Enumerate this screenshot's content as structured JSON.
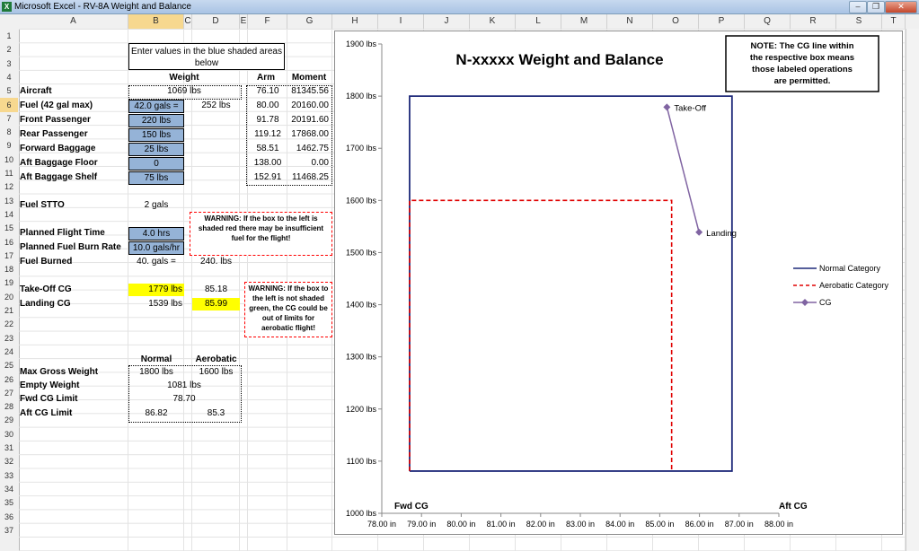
{
  "window": {
    "title": "Microsoft Excel - RV-8A Weight and Balance",
    "app_icon": "excel-icon",
    "buttons": [
      "minimize",
      "restore",
      "close"
    ]
  },
  "columns": [
    "A",
    "B",
    "C",
    "D",
    "E",
    "F",
    "G",
    "H",
    "I",
    "J",
    "K",
    "L",
    "M",
    "N",
    "O",
    "P",
    "Q",
    "R",
    "S",
    "T"
  ],
  "selected_column": "B",
  "rows": [
    "1",
    "2",
    "3",
    "4",
    "5",
    "6",
    "7",
    "8",
    "9",
    "10",
    "11",
    "12",
    "13",
    "14",
    "15",
    "16",
    "17",
    "18",
    "19",
    "20",
    "21",
    "22",
    "23",
    "24",
    "25",
    "26",
    "27",
    "28",
    "29",
    "30",
    "31",
    "32",
    "33",
    "34",
    "35",
    "36",
    "37"
  ],
  "selected_row": "6",
  "sheet": {
    "instruction": "Enter values in the blue shaded areas below",
    "headers": {
      "weight": "Weight",
      "arm": "Arm",
      "moment": "Moment"
    },
    "items": [
      {
        "label": "Aircraft",
        "weight": "1069 lbs",
        "weight2": "",
        "arm": "76.10",
        "moment": "81345.56"
      },
      {
        "label": "Fuel (42 gal max)",
        "weight": "42.0 gals =",
        "weight2": "252 lbs",
        "arm": "80.00",
        "moment": "20160.00"
      },
      {
        "label": "Front Passenger",
        "weight": "220 lbs",
        "weight2": "",
        "arm": "91.78",
        "moment": "20191.60"
      },
      {
        "label": "Rear Passenger",
        "weight": "150 lbs",
        "weight2": "",
        "arm": "119.12",
        "moment": "17868.00"
      },
      {
        "label": "Forward Baggage",
        "weight": "25 lbs",
        "weight2": "",
        "arm": "58.51",
        "moment": "1462.75"
      },
      {
        "label": "Aft Baggage Floor",
        "weight": "0",
        "weight2": "",
        "arm": "138.00",
        "moment": "0.00"
      },
      {
        "label": "Aft Baggage Shelf",
        "weight": "75 lbs",
        "weight2": "",
        "arm": "152.91",
        "moment": "11468.25"
      }
    ],
    "fuel_stto": {
      "label": "Fuel STTO",
      "value": "2 gals"
    },
    "flight_time": {
      "label": "Planned Flight Time",
      "value": "4.0 hrs"
    },
    "burn_rate": {
      "label": "Planned Fuel Burn Rate",
      "value": "10.0 gals/hr"
    },
    "fuel_burned": {
      "label": "Fuel Burned",
      "value": "40. gals =",
      "value2": "240. lbs"
    },
    "warning1": "WARNING: If the box to the left is shaded red there may be insufficient fuel for the flight!",
    "takeoff_cg": {
      "label": "Take-Off CG",
      "weight": "1779 lbs",
      "arm": "85.18"
    },
    "landing_cg": {
      "label": "Landing CG",
      "weight": "1539 lbs",
      "arm": "85.99"
    },
    "warning2": "WARNING: If the box to the left is not shaded green, the CG could be out of limits for aerobatic flight!",
    "limits_headers": {
      "normal": "Normal",
      "aerobatic": "Aerobatic"
    },
    "max_gross": {
      "label": "Max Gross Weight",
      "normal": "1800 lbs",
      "aerobatic": "1600 lbs"
    },
    "empty_weight": {
      "label": "Empty Weight",
      "value": "1081 lbs"
    },
    "fwd_cg": {
      "label": "Fwd CG Limit",
      "value": "78.70"
    },
    "aft_cg": {
      "label": "Aft CG Limit",
      "normal": "86.82",
      "aerobatic": "85.3"
    }
  },
  "chart_data": {
    "type": "line",
    "title": "N-xxxxx Weight and Balance",
    "note": "NOTE: The CG line within the respective box means those labeled operations are permitted.",
    "xlabel_left": "Fwd CG",
    "xlabel_right": "Aft CG",
    "xlim": [
      78,
      88
    ],
    "ylim": [
      1000,
      1900
    ],
    "xticks": [
      "78.00 in",
      "79.00 in",
      "80.00 in",
      "81.00 in",
      "82.00 in",
      "83.00 in",
      "84.00 in",
      "85.00 in",
      "86.00 in",
      "87.00 in",
      "88.00 in"
    ],
    "yticks": [
      "1000 lbs",
      "1100 lbs",
      "1200 lbs",
      "1300 lbs",
      "1400 lbs",
      "1500 lbs",
      "1600 lbs",
      "1700 lbs",
      "1800 lbs",
      "1900 lbs"
    ],
    "series": [
      {
        "name": "Normal Category",
        "color": "#1f2a7a",
        "style": "solid",
        "x": [
          78.7,
          78.7,
          86.82,
          86.82,
          78.7
        ],
        "y": [
          1081,
          1800,
          1800,
          1081,
          1081
        ]
      },
      {
        "name": "Aerobatic Category",
        "color": "#e00000",
        "style": "dashed",
        "x": [
          78.7,
          78.7,
          85.3,
          85.3
        ],
        "y": [
          1081,
          1600,
          1600,
          1081
        ]
      },
      {
        "name": "CG",
        "color": "#8064a2",
        "style": "marker",
        "x": [
          85.18,
          85.99
        ],
        "y": [
          1779,
          1539
        ],
        "labels": [
          "Take-Off",
          "Landing"
        ]
      }
    ],
    "legend": "right"
  }
}
